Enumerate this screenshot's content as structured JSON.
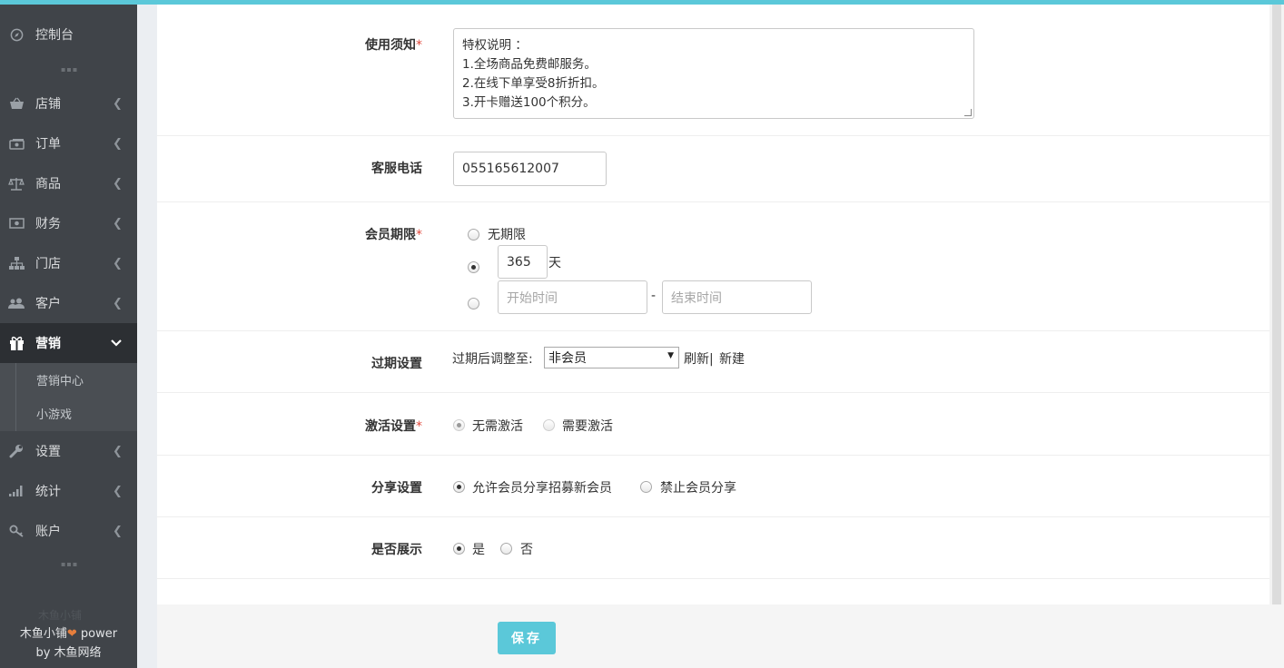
{
  "sidebar": {
    "items": [
      {
        "label": "控制台",
        "icon": "dashboard-icon"
      },
      {
        "label": "店铺",
        "icon": "shop-basket-icon"
      },
      {
        "label": "订单",
        "icon": "order-icon"
      },
      {
        "label": "商品",
        "icon": "scale-icon"
      },
      {
        "label": "财务",
        "icon": "money-icon"
      },
      {
        "label": "门店",
        "icon": "sitemap-icon"
      },
      {
        "label": "客户",
        "icon": "users-icon"
      },
      {
        "label": "营销",
        "icon": "gift-icon"
      },
      {
        "label": "设置",
        "icon": "wrench-icon"
      },
      {
        "label": "统计",
        "icon": "signal-bars-icon"
      },
      {
        "label": "账户",
        "icon": "key-icon"
      }
    ],
    "submenu": [
      {
        "label": "营销中心"
      },
      {
        "label": "小游戏"
      }
    ],
    "footer_ghost": "木鱼小铺",
    "footer_line1": "木鱼小铺",
    "footer_heart": "❤",
    "footer_power": " power",
    "footer_line2": "by 木鱼网络"
  },
  "form": {
    "usage": {
      "label": "使用须知",
      "required": "*",
      "lines": [
        "特权说明 ：",
        "1.全场商品免费邮服务。",
        "2.在线下单享受8折折扣。",
        "3.开卡赠送100个积分。"
      ]
    },
    "phone": {
      "label": "客服电话",
      "value": "055165612007"
    },
    "period": {
      "label": "会员期限",
      "required": "*",
      "opt_unlimited": "无期限",
      "days_value": "365",
      "days_unit": "天",
      "start_placeholder": "开始时间",
      "dash": "-",
      "end_placeholder": "结束时间"
    },
    "expire": {
      "label": "过期设置",
      "prefix": "过期后调整至:",
      "selected": "非会员",
      "refresh": "刷新|",
      "new": "新建"
    },
    "activate": {
      "label": "激活设置",
      "required": "*",
      "opt1": "无需激活",
      "opt2": "需要激活"
    },
    "share": {
      "label": "分享设置",
      "opt1": "允许会员分享招募新会员",
      "opt2": "禁止会员分享"
    },
    "display": {
      "label": "是否展示",
      "opt1": "是",
      "opt2": "否"
    }
  },
  "actions": {
    "save": "保存"
  },
  "colors": {
    "accent": "#5bc8d9",
    "sidebar": "#404449",
    "required": "#e0493c"
  }
}
